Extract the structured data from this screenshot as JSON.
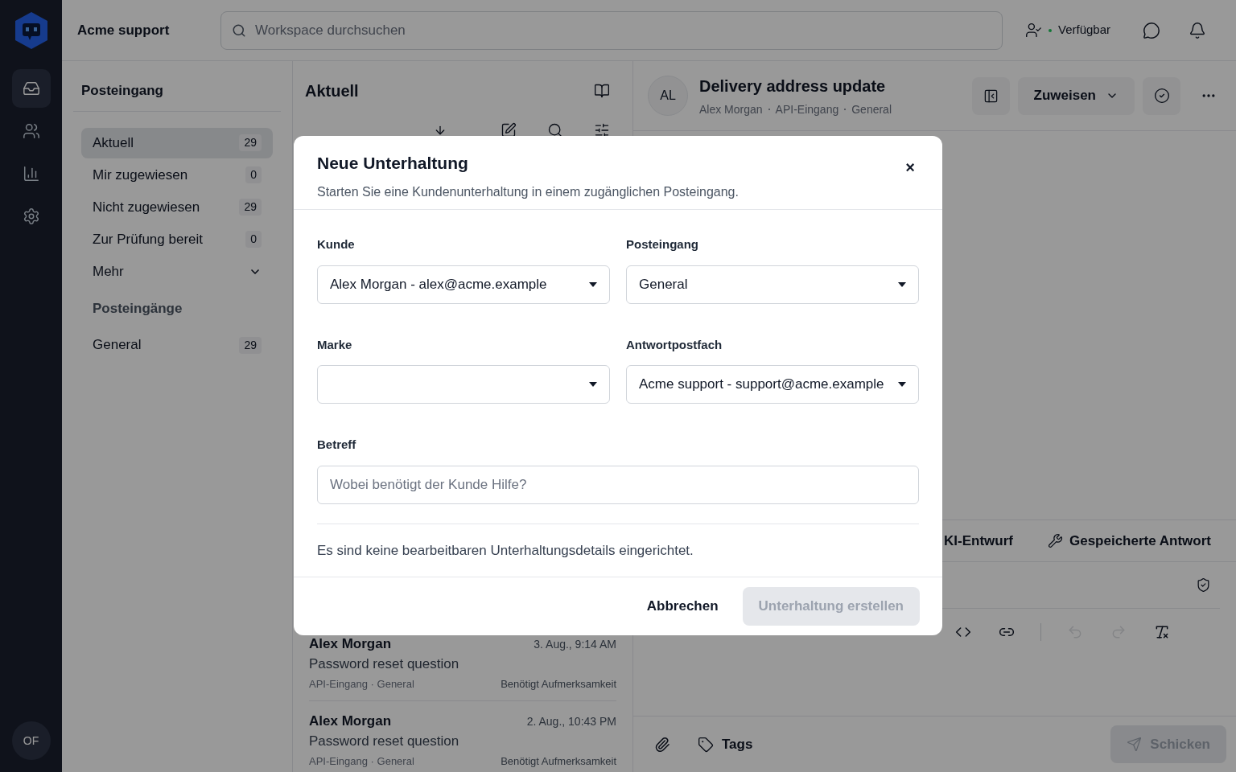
{
  "topbar": {
    "workspace": "Acme support",
    "search": {
      "placeholder": "Workspace durchsuchen"
    },
    "status": {
      "label": "Verfügbar",
      "online": true
    }
  },
  "rail": {
    "items": [
      {
        "kind": "inbox",
        "selected": true
      },
      {
        "kind": "contacts",
        "selected": false
      },
      {
        "kind": "reports",
        "selected": false
      },
      {
        "kind": "settings",
        "selected": false
      }
    ],
    "avatar": "OF"
  },
  "nav": {
    "title": "Posteingang",
    "items": [
      {
        "label": "Aktuell",
        "count": "29",
        "selected": true
      },
      {
        "label": "Mir zugewiesen",
        "count": "0",
        "selected": false
      },
      {
        "label": "Nicht zugewiesen",
        "count": "29",
        "selected": false
      },
      {
        "label": "Zur Prüfung bereit",
        "count": "0",
        "selected": false
      }
    ],
    "more": "Mehr",
    "section": "Posteingänge",
    "inboxes": [
      {
        "label": "General",
        "count": "29",
        "selected": false
      }
    ]
  },
  "list": {
    "title": "Aktuell",
    "items": [
      {
        "name": "Alex Morgan",
        "time": "3. Aug., 9:14 AM",
        "subject": "Password reset question",
        "meta": "API-Eingang · General",
        "status": "Benötigt Aufmerksamkeit"
      },
      {
        "name": "Alex Morgan",
        "time": "2. Aug., 10:43 PM",
        "subject": "Password reset question",
        "meta": "API-Eingang · General",
        "status": "Benötigt Aufmerksamkeit"
      }
    ]
  },
  "conversation": {
    "avatar": "AL",
    "title": "Delivery address update",
    "meta": [
      "Alex Morgan",
      "API-Eingang",
      "General"
    ],
    "assign": "Zuweisen",
    "composer": {
      "tabs": [
        "KI-Entwurf",
        "Gespeicherte Antwort"
      ],
      "toolbar": [
        {
          "kind": "code",
          "disabled": false
        },
        {
          "kind": "link",
          "disabled": false
        },
        {
          "kind": "divider"
        },
        {
          "kind": "undo",
          "disabled": true
        },
        {
          "kind": "redo",
          "disabled": true
        },
        {
          "kind": "clear",
          "disabled": false
        }
      ],
      "tags": "Tags",
      "send": {
        "label": "Schicken",
        "disabled": true
      }
    }
  },
  "dialog": {
    "title": "Neue Unterhaltung",
    "subtitle": "Starten Sie eine Kundenunterhaltung in einem zugänglichen Posteingang.",
    "close": "×",
    "fields": [
      {
        "label": "Kunde",
        "value": "Alex Morgan - alex@acme.example"
      },
      {
        "label": "Posteingang",
        "value": "General"
      },
      {
        "label": "Marke"
      },
      {
        "label": "Antwortpostfach",
        "value": "Acme support - support@acme.example"
      }
    ],
    "subject": {
      "label": "Betreff",
      "placeholder": "Wobei benötigt der Kunde Hilfe?"
    },
    "note": "Es sind keine bearbeitbaren Unterhaltungsdetails eingerichtet.",
    "cancel": "Abbrechen",
    "submit": {
      "label": "Unterhaltung erstellen",
      "disabled": true
    }
  }
}
